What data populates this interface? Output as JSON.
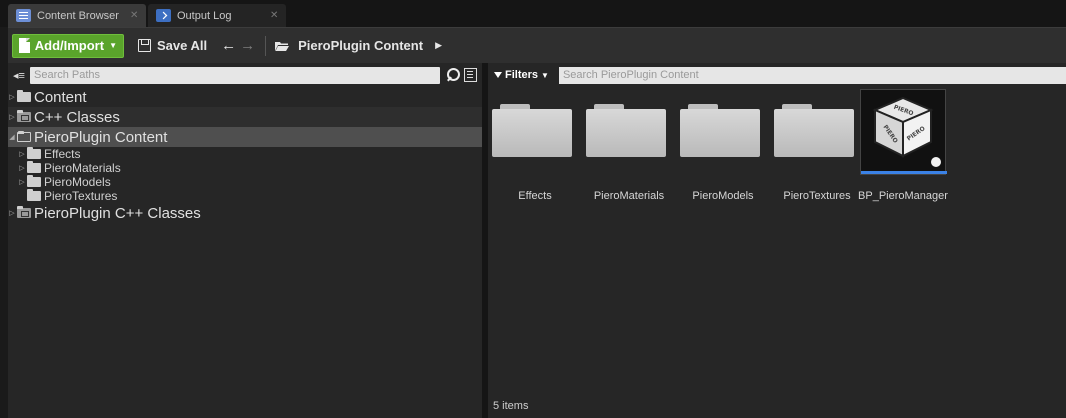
{
  "tabs": [
    {
      "label": "Content Browser",
      "icon": "content-browser-icon"
    },
    {
      "label": "Output Log",
      "icon": "output-log-icon"
    }
  ],
  "toolbar": {
    "add_import_label": "Add/Import",
    "save_all_label": "Save All",
    "path_label": "PieroPlugin Content"
  },
  "sources": {
    "search_placeholder": "Search Paths",
    "tree": [
      {
        "label": "Content",
        "level": 0
      },
      {
        "label": "C++ Classes",
        "level": 0
      },
      {
        "label": "PieroPlugin Content",
        "level": 0,
        "selected": true
      },
      {
        "label": "Effects",
        "level": 1
      },
      {
        "label": "PieroMaterials",
        "level": 1
      },
      {
        "label": "PieroModels",
        "level": 1
      },
      {
        "label": "PieroTextures",
        "level": 1
      },
      {
        "label": "PieroPlugin C++ Classes",
        "level": 0
      }
    ]
  },
  "assets": {
    "filters_label": "Filters",
    "search_placeholder": "Search PieroPlugin Content",
    "items": [
      {
        "label": "Effects",
        "type": "folder"
      },
      {
        "label": "PieroMaterials",
        "type": "folder"
      },
      {
        "label": "PieroModels",
        "type": "folder"
      },
      {
        "label": "PieroTextures",
        "type": "folder"
      },
      {
        "label": "BP_PieroManager",
        "type": "blueprint"
      }
    ],
    "count_label": "5 items",
    "thumbnail_text": "PIERO"
  },
  "colors": {
    "accent_green": "#5aa42b",
    "selection_blue": "#3b82e6"
  }
}
